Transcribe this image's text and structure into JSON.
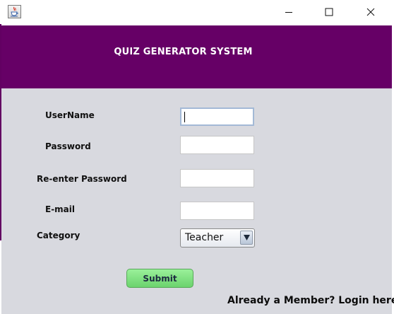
{
  "window": {
    "icon": "java-cup-icon",
    "controls": [
      "minimize-icon",
      "maximize-icon",
      "close-icon"
    ]
  },
  "header": {
    "title": "QUIZ GENERATOR SYSTEM",
    "background_color": "#660066",
    "text_color": "#ffffff"
  },
  "form": {
    "username_label": "UserName",
    "username_value": "",
    "password_label": "Password",
    "password_value": "",
    "reenter_label": "Re-enter Password",
    "reenter_value": "",
    "email_label": "E-mail",
    "email_value": "",
    "category_label": "Category",
    "category_selected": "Teacher",
    "submit_label": "Submit",
    "submit_color": "#7ee07f"
  },
  "footer": {
    "login_text": "Already a Member? Login here"
  },
  "colors": {
    "content_background": "#d8d9df"
  }
}
